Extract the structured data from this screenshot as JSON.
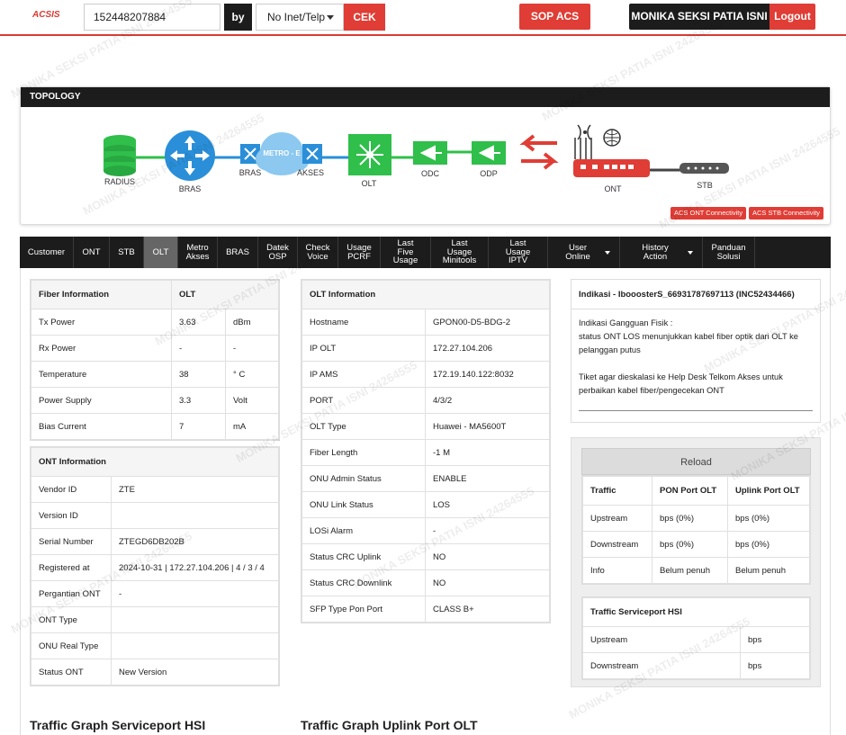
{
  "header": {
    "logo": "ACSIS",
    "search_value": "152448207884",
    "by_label": "by",
    "select_value": "No Inet/Telp",
    "cek_label": "CEK",
    "sop_label": "SOP ACS",
    "user_name": "MONIKA SEKSI PATIA ISNI",
    "logout_label": "Logout"
  },
  "topology": {
    "title": "TOPOLOGY",
    "labels": {
      "radius": "RADIUS",
      "bras": "BRAS",
      "bras2": "BRAS",
      "metro": "METRO - E",
      "akses": "AKSES",
      "olt": "OLT",
      "odc": "ODC",
      "odp": "ODP",
      "ont": "ONT",
      "stb": "STB"
    },
    "acs_ont": "ACS ONT Connectivity",
    "acs_stb": "ACS STB Connectivity",
    "colors": {
      "blue": "#2a8fd8",
      "green": "#2fbf4a",
      "red": "#df3d35"
    }
  },
  "tabs": [
    {
      "l1": "Customer"
    },
    {
      "l1": "ONT"
    },
    {
      "l1": "STB"
    },
    {
      "l1": "OLT",
      "active": true
    },
    {
      "l1": "Metro",
      "l2": "Akses"
    },
    {
      "l1": "BRAS"
    },
    {
      "l1": "Datek",
      "l2": "OSP"
    },
    {
      "l1": "Check",
      "l2": "Voice"
    },
    {
      "l1": "Usage",
      "l2": "PCRF"
    },
    {
      "l1": "Last Five",
      "l2": "Usage"
    },
    {
      "l1": "Last Usage",
      "l2": "Minitools"
    },
    {
      "l1": "Last Usage",
      "l2": "IPTV"
    },
    {
      "l1": "User Online",
      "dropdown": true
    },
    {
      "l1": "History Action",
      "dropdown": true
    },
    {
      "l1": "Panduan",
      "l2": "Solusi"
    }
  ],
  "fiber": {
    "h1": "Fiber Information",
    "h2": "OLT",
    "rows": [
      {
        "label": "Tx Power",
        "value": "3.63",
        "unit": "dBm"
      },
      {
        "label": "Rx Power",
        "value": "-",
        "unit": "-"
      },
      {
        "label": "Temperature",
        "value": "38",
        "unit": "° C"
      },
      {
        "label": "Power Supply",
        "value": "3.3",
        "unit": "Volt"
      },
      {
        "label": "Bias Current",
        "value": "7",
        "unit": "mA"
      }
    ]
  },
  "ont": {
    "title": "ONT Information",
    "rows": [
      {
        "label": "Vendor ID",
        "value": "ZTE"
      },
      {
        "label": "Version ID",
        "value": ""
      },
      {
        "label": "Serial Number",
        "value": "ZTEGD6DB202B"
      },
      {
        "label": "Registered at",
        "value": "2024-10-31 | 172.27.104.206 | 4 / 3 / 4"
      },
      {
        "label": "Pergantian ONT",
        "value": "-"
      },
      {
        "label": "ONT Type",
        "value": ""
      },
      {
        "label": "ONU Real Type",
        "value": ""
      },
      {
        "label": "Status ONT",
        "value": "New Version"
      }
    ]
  },
  "olt": {
    "title": "OLT Information",
    "rows": [
      {
        "label": "Hostname",
        "value": "GPON00-D5-BDG-2"
      },
      {
        "label": "IP OLT",
        "value": "172.27.104.206"
      },
      {
        "label": "IP AMS",
        "value": "172.19.140.122:8032"
      },
      {
        "label": "PORT",
        "value": "4/3/2"
      },
      {
        "label": "OLT Type",
        "value": "Huawei - MA5600T"
      },
      {
        "label": "Fiber Length",
        "value": "-1 M"
      },
      {
        "label": "ONU Admin Status",
        "value": "ENABLE"
      },
      {
        "label": "ONU Link Status",
        "value": "LOS"
      },
      {
        "label": "LOSi Alarm",
        "value": "-"
      },
      {
        "label": "Status CRC Uplink",
        "value": "NO"
      },
      {
        "label": "Status CRC Downlink",
        "value": "NO"
      },
      {
        "label": "SFP Type Pon Port",
        "value": "CLASS B+"
      }
    ]
  },
  "indikasi": {
    "title": "Indikasi - IbooosterS_66931787697113 (INC52434466)",
    "line1": "Indikasi Gangguan Fisik :",
    "line2": "status ONT LOS menunjukkan kabel fiber optik dari OLT ke pelanggan putus",
    "line3": "Tiket agar dieskalasi ke Help Desk Telkom Akses untuk perbaikan kabel fiber/pengecekan ONT"
  },
  "traffic": {
    "reload_label": "Reload",
    "headers": [
      "Traffic",
      "PON Port OLT",
      "Uplink Port OLT"
    ],
    "rows": [
      [
        "Upstream",
        "bps (0%)",
        "bps (0%)"
      ],
      [
        "Downstream",
        "bps (0%)",
        "bps (0%)"
      ],
      [
        "Info",
        "Belum penuh",
        "Belum penuh"
      ]
    ],
    "hsi_title": "Traffic Serviceport HSI",
    "hsi_rows": [
      [
        "Upstream",
        "bps"
      ],
      [
        "Downstream",
        "bps"
      ]
    ]
  },
  "sections": {
    "graph_hsi": "Traffic Graph Serviceport HSI",
    "graph_uplink": "Traffic Graph Uplink Port OLT"
  },
  "watermark": "MONIKA SEKSI PATIA ISNI 24264555"
}
